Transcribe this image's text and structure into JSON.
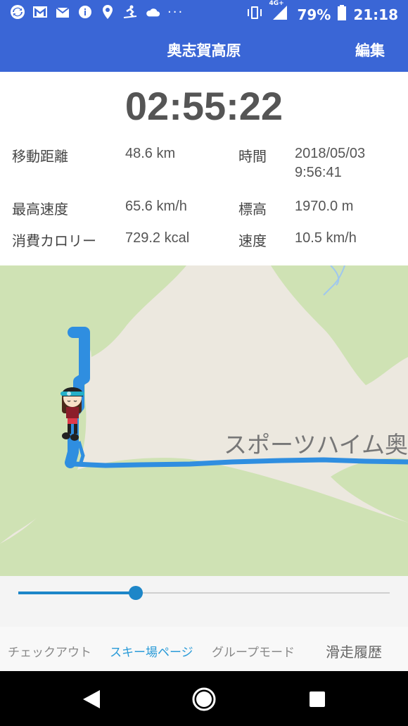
{
  "status_bar": {
    "battery": "79%",
    "time": "21:18",
    "network": "4G+",
    "dots": "···",
    "icons": [
      "sync-icon",
      "gmail-icon",
      "mail-icon",
      "info-icon",
      "location-icon",
      "ski-icon",
      "cloud-icon",
      "vibrate-icon",
      "signal-icon",
      "battery-icon"
    ]
  },
  "app_bar": {
    "title": "奥志賀高原",
    "edit_label": "編集"
  },
  "timer": "02:55:22",
  "stats": {
    "distance_label": "移動距離",
    "distance_value": "48.6 km",
    "time_label": "時間",
    "time_value_date": "2018/05/03",
    "time_value_clock": "9:56:41",
    "max_speed_label": "最高速度",
    "max_speed_value": "65.6 km/h",
    "altitude_label": "標高",
    "altitude_value": "1970.0 m",
    "calories_label": "消費カロリー",
    "calories_value": "729.2 kcal",
    "speed_label": "速度",
    "speed_value": "10.5 km/h"
  },
  "map": {
    "place_label": "スポーツハイム奥",
    "land_color": "#ece8df",
    "green_color": "#cfe2b4",
    "track_color": "#2f8ee0"
  },
  "slider": {
    "progress": 0.316
  },
  "tabs": [
    {
      "label": "チェックアウト",
      "active": false
    },
    {
      "label": "スキー場ページ",
      "active": true
    },
    {
      "label": "グループモード",
      "active": false
    },
    {
      "label": "滑走履歴",
      "active": false
    }
  ],
  "nav": {
    "icons": [
      "back-icon",
      "home-icon",
      "recents-icon"
    ]
  }
}
